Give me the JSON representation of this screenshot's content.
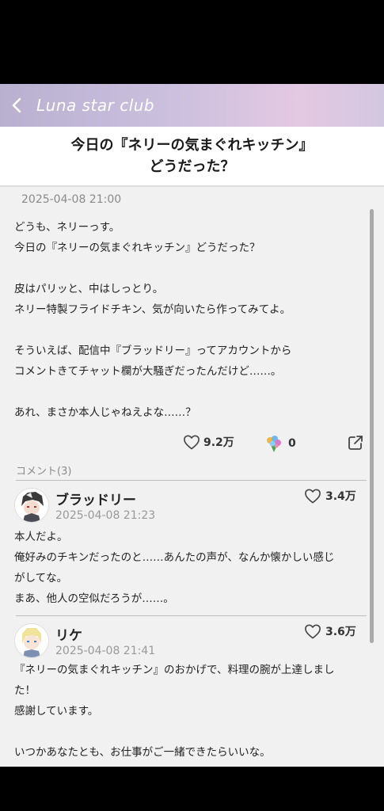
{
  "app_bar": {
    "title": "Luna star club"
  },
  "post": {
    "title_line1": "今日の『ネリーの気まぐれキッチン』",
    "title_line2": "どうだった？",
    "date": "2025-04-08 21:00",
    "lines": [
      "どうも、ネリーっす。",
      "今日の『ネリーの気まぐれキッチン』どうだった？",
      "",
      "皮はパリッと、中はしっとり。",
      "ネリー特製フライドチキン、気が向いたら作ってみてよ。",
      "",
      "そういえば、配信中『ブラッドリー』ってアカウントから",
      "コメントきてチャット欄が大騒ぎだったんだけど……。",
      "",
      "あれ、まさか本人じゃねえよな……？"
    ],
    "likes": "9.2万",
    "gifts": "0"
  },
  "comments_header": "コメント(3)",
  "comments": [
    {
      "name": "ブラッドリー",
      "date": "2025-04-08 21:23",
      "likes": "3.4万",
      "lines": [
        "本人だよ。",
        "俺好みのチキンだったのと……あんたの声が、なんか懐かしい感じ",
        "がしてな。",
        "まあ、他人の空似だろうが……。"
      ]
    },
    {
      "name": "リケ",
      "date": "2025-04-08 21:41",
      "likes": "3.6万",
      "lines": [
        "『ネリーの気まぐれキッチン』のおかげで、料理の腕が上達しまし",
        "た！",
        "感謝しています。",
        "",
        "いつかあなたとも、お仕事がご一緒できたらいいな。"
      ]
    }
  ]
}
